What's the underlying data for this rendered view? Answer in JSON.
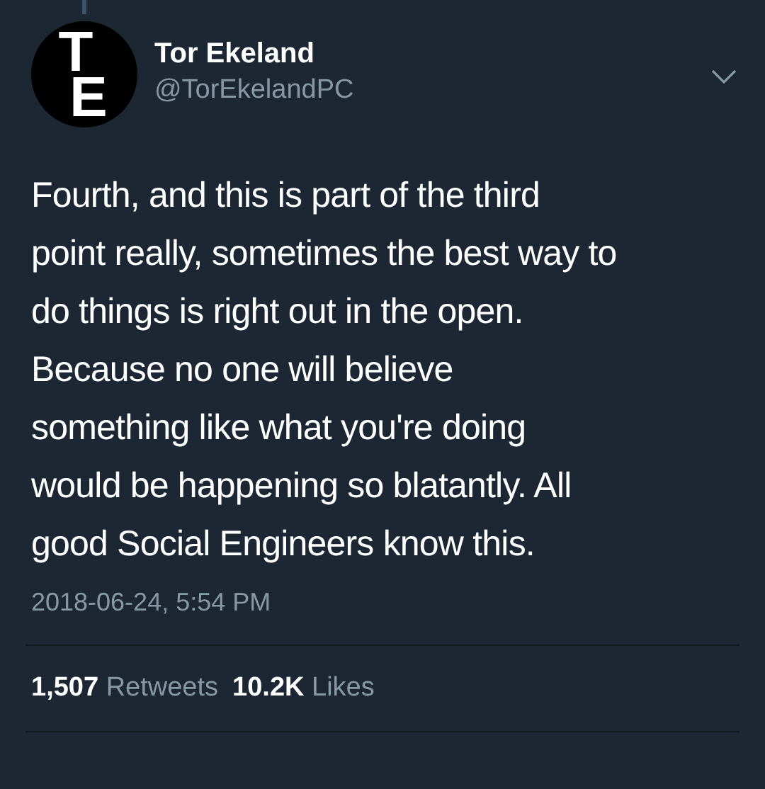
{
  "tweet": {
    "author": {
      "avatar_letters": [
        "T",
        "E"
      ],
      "name": "Tor Ekeland",
      "handle": "@TorEkelandPC"
    },
    "text_lines": [
      "Fourth, and this is part of the third",
      "point really, sometimes the best way to",
      "do things is right out in the open.",
      "Because no one will believe",
      "something like what you're doing",
      "would be happening so blatantly. All",
      "good Social Engineers know this."
    ],
    "timestamp": "2018-06-24, 5:54 PM",
    "stats": [
      {
        "count": "1,507",
        "label": "Retweets"
      },
      {
        "count": "10.2K",
        "label": "Likes"
      }
    ]
  }
}
